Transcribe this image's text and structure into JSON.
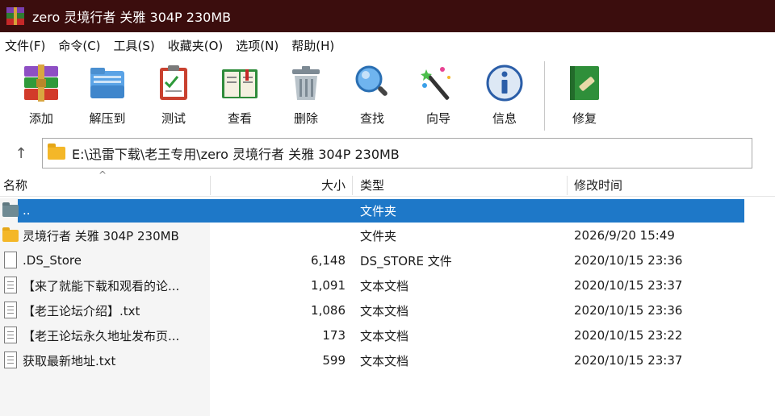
{
  "window": {
    "title": "zero 灵境行者 关雅 304P 230MB"
  },
  "menu": [
    "文件(F)",
    "命令(C)",
    "工具(S)",
    "收藏夹(O)",
    "选项(N)",
    "帮助(H)"
  ],
  "toolbar": {
    "add": "添加",
    "extract": "解压到",
    "test": "测试",
    "view": "查看",
    "delete": "删除",
    "find": "查找",
    "wizard": "向导",
    "info": "信息",
    "repair": "修复"
  },
  "address": {
    "path": "E:\\迅雷下载\\老王专用\\zero 灵境行者 关雅 304P 230MB",
    "up_icon": "↑"
  },
  "columns": {
    "name": "名称",
    "size": "大小",
    "type": "类型",
    "modified": "修改时间",
    "sort_indicator": "^"
  },
  "files": [
    {
      "name": "..",
      "size": "",
      "type": "文件夹",
      "modified": "",
      "icon": "folder-up",
      "selected": true
    },
    {
      "name": "灵境行者 关雅 304P 230MB",
      "size": "",
      "type": "文件夹",
      "modified": "2026/9/20 15:49",
      "icon": "folder"
    },
    {
      "name": ".DS_Store",
      "size": "6,148",
      "type": "DS_STORE 文件",
      "modified": "2020/10/15 23:36",
      "icon": "file"
    },
    {
      "name": "【来了就能下载和观看的论...",
      "size": "1,091",
      "type": "文本文档",
      "modified": "2020/10/15 23:37",
      "icon": "text-file"
    },
    {
      "name": "【老王论坛介绍】.txt",
      "size": "1,086",
      "type": "文本文档",
      "modified": "2020/10/15 23:36",
      "icon": "text-file"
    },
    {
      "name": "【老王论坛永久地址发布页...",
      "size": "173",
      "type": "文本文档",
      "modified": "2020/10/15 23:22",
      "icon": "text-file"
    },
    {
      "name": "获取最新地址.txt",
      "size": "599",
      "type": "文本文档",
      "modified": "2020/10/15 23:37",
      "icon": "text-file"
    }
  ],
  "colors": {
    "titlebar": "#3b0d0d",
    "selection": "#1e78c8",
    "folder": "#f4b728"
  }
}
